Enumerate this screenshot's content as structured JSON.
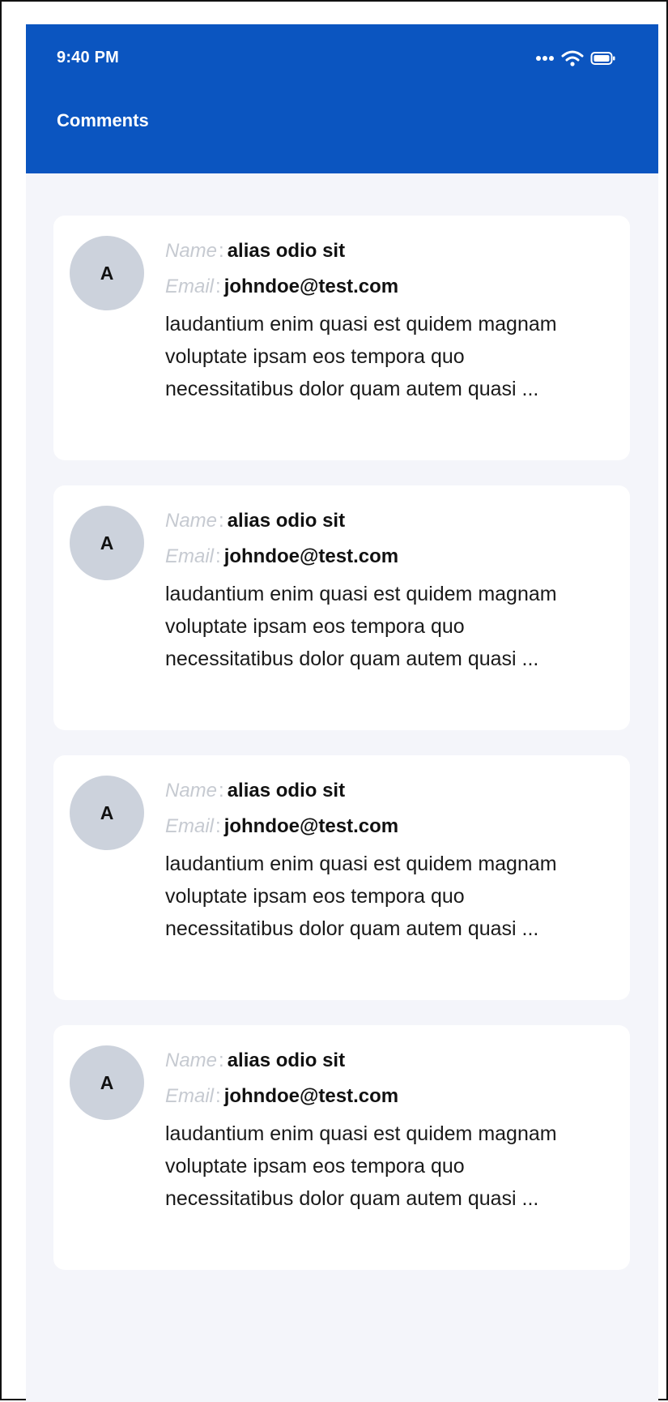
{
  "status_bar": {
    "time": "9:40 PM",
    "icons": [
      "more-dots-icon",
      "wifi-icon",
      "battery-icon"
    ]
  },
  "header": {
    "title": "Comments",
    "background": "#0b55c0"
  },
  "labels": {
    "name": "Name",
    "email": "Email",
    "separator": ":"
  },
  "comments": [
    {
      "avatar_initial": "A",
      "name": "alias odio sit",
      "email": "johndoe@test.com",
      "body": "laudantium enim quasi est quidem magnam voluptate ipsam eos tempora quo necessitatibus dolor quam autem quasi ..."
    },
    {
      "avatar_initial": "A",
      "name": "alias odio sit",
      "email": "johndoe@test.com",
      "body": "laudantium enim quasi est quidem magnam voluptate ipsam eos tempora quo necessitatibus dolor quam autem quasi ..."
    },
    {
      "avatar_initial": "A",
      "name": "alias odio sit",
      "email": "johndoe@test.com",
      "body": "laudantium enim quasi est quidem magnam voluptate ipsam eos tempora quo necessitatibus dolor quam autem quasi ..."
    },
    {
      "avatar_initial": "A",
      "name": "alias odio sit",
      "email": "johndoe@test.com",
      "body": "laudantium enim quasi est quidem magnam voluptate ipsam eos tempora quo necessitatibus dolor quam autem quasi ..."
    }
  ]
}
